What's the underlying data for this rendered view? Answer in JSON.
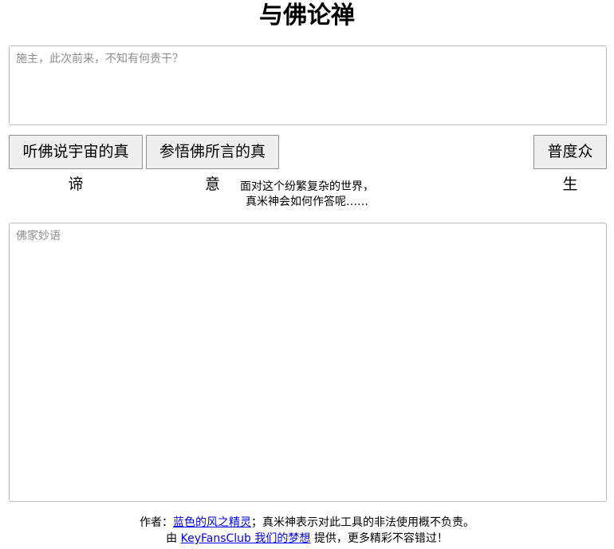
{
  "page": {
    "title": "与佛论禅"
  },
  "input": {
    "placeholder": "施主，此次前来，不知有何贵干？",
    "value": ""
  },
  "buttons": {
    "encrypt_label": "听佛说宇宙的真谛",
    "decrypt_label": "参悟佛所言的真意",
    "share_label": "普度众生"
  },
  "prompt": {
    "line1": "面对这个纷繁复杂的世界，",
    "line2": "真米神会如何作答呢……"
  },
  "output": {
    "placeholder": "佛家妙语",
    "value": ""
  },
  "footer": {
    "author_prefix": "作者：",
    "author_link": "蓝色的风之精灵",
    "disclaimer": "；真米神表示对此工具的非法使用概不负责。",
    "provider_prefix": "由 ",
    "provider_link": "KeyFansClub 我们的梦想",
    "provider_suffix": " 提供，更多精彩不容错过！"
  },
  "colors": {
    "link": "#0000ee",
    "button_bg": "#efefef",
    "border": "#b8b8b8",
    "placeholder": "#8c8c8c"
  }
}
